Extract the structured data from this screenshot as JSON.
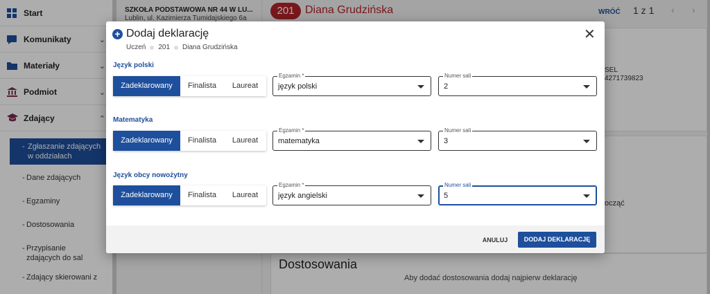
{
  "sidebar": {
    "items": [
      {
        "label": "Start",
        "icon": "grid-icon"
      },
      {
        "label": "Komunikaty",
        "icon": "message-icon"
      },
      {
        "label": "Materiały",
        "icon": "folder-icon"
      },
      {
        "label": "Podmiot",
        "icon": "institution-icon"
      },
      {
        "label": "Zdający",
        "icon": "graduation-cap-icon"
      }
    ],
    "subitems": [
      "Zgłaszanie zdających w oddziałach",
      "Dane zdających",
      "Egzaminy",
      "Dostosowania",
      "Przypisanie zdających do sal",
      "Zdający skierowani z"
    ]
  },
  "school": {
    "name": "SZKOŁA PODSTAWOWA NR 44 W LU...",
    "address": "Lublin, ul. Kazimierza Tumidajskiego 6a"
  },
  "student_header": {
    "number": "201",
    "name": "Diana Grudzińska",
    "back_label": "WRÓĆ",
    "pager": "1 z 1"
  },
  "background": {
    "pesel_label": "SEL",
    "pesel_value": "4271739823",
    "side_text": "ocząć",
    "dost_title": "Dostosowania",
    "dost_info": "Aby dodać dostosowania dodaj najpierw deklarację"
  },
  "modal": {
    "title": "Dodaj deklarację",
    "crumb_label": "Uczeń",
    "crumb_number": "201",
    "crumb_name": "Diana Grudzińska",
    "segment_labels": {
      "declared": "Zadeklarowany",
      "finalist": "Finalista",
      "laureate": "Laureat"
    },
    "exam_label": "Egzamin *",
    "room_label": "Numer sali",
    "sections": [
      {
        "title": "Język polski",
        "exam": "język polski",
        "room": "2"
      },
      {
        "title": "Matematyka",
        "exam": "matematyka",
        "room": "3"
      },
      {
        "title": "Język obcy nowożytny",
        "exam": "język angielski",
        "room": "5"
      }
    ],
    "cancel_label": "ANULUJ",
    "submit_label": "DODAJ DEKLARACJĘ"
  },
  "colors": {
    "primary": "#1e4f9c",
    "danger": "#b3242a"
  }
}
